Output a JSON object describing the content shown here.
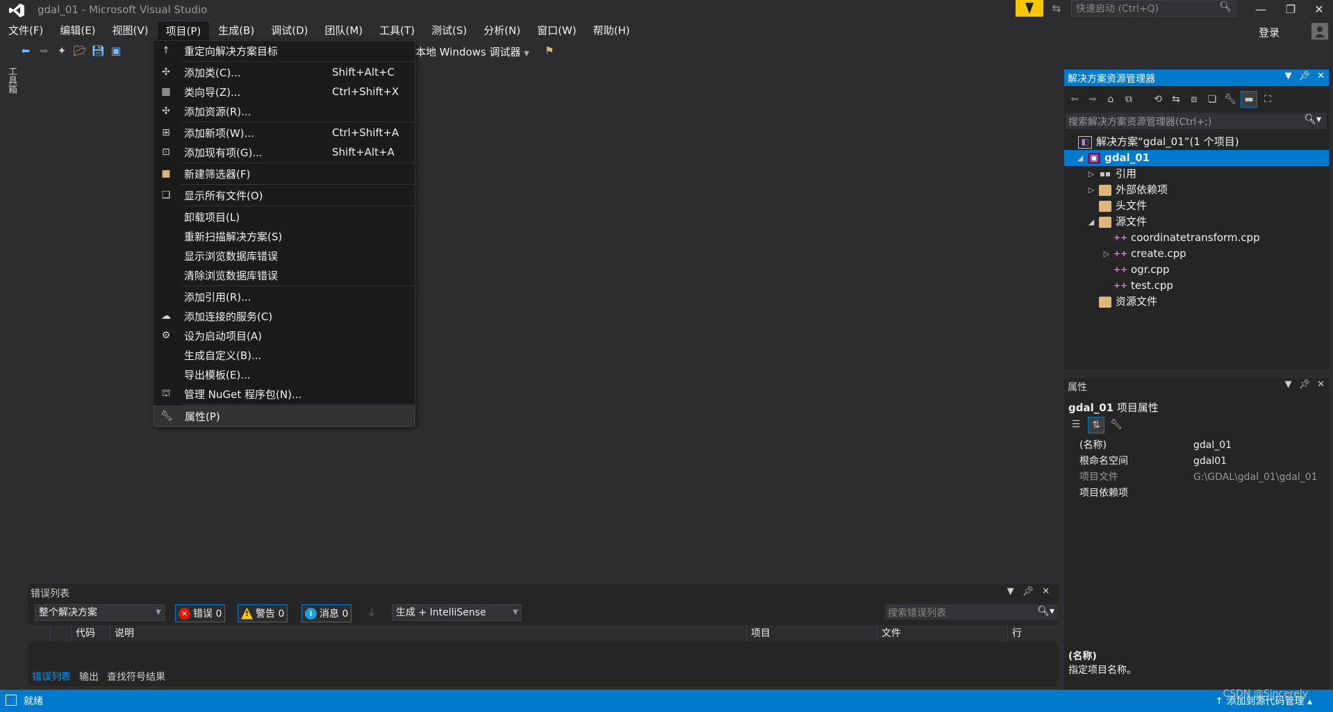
{
  "window": {
    "title": "gdal_01 - Microsoft Visual Studio"
  },
  "quick_launch": {
    "placeholder": "快速启动 (Ctrl+Q)"
  },
  "menubar": [
    {
      "label": "文件(F)"
    },
    {
      "label": "编辑(E)"
    },
    {
      "label": "视图(V)"
    },
    {
      "label": "项目(P)"
    },
    {
      "label": "生成(B)"
    },
    {
      "label": "调试(D)"
    },
    {
      "label": "团队(M)"
    },
    {
      "label": "工具(T)"
    },
    {
      "label": "测试(S)"
    },
    {
      "label": "分析(N)"
    },
    {
      "label": "窗口(W)"
    },
    {
      "label": "帮助(H)"
    }
  ],
  "account": {
    "login": "登录"
  },
  "toolbar": {
    "debugger": "本地 Windows 调试器"
  },
  "toolbox": {
    "label": "工具箱"
  },
  "project_menu": [
    {
      "label": "重定向解决方案目标",
      "shortcut": ""
    },
    {
      "label": "添加类(C)...",
      "shortcut": "Shift+Alt+C"
    },
    {
      "label": "类向导(Z)...",
      "shortcut": "Ctrl+Shift+X"
    },
    {
      "label": "添加资源(R)...",
      "shortcut": ""
    },
    {
      "label": "添加新项(W)...",
      "shortcut": "Ctrl+Shift+A"
    },
    {
      "label": "添加现有项(G)...",
      "shortcut": "Shift+Alt+A"
    },
    {
      "label": "新建筛选器(F)",
      "shortcut": ""
    },
    {
      "label": "显示所有文件(O)",
      "shortcut": ""
    },
    {
      "label": "卸载项目(L)",
      "shortcut": ""
    },
    {
      "label": "重新扫描解决方案(S)",
      "shortcut": ""
    },
    {
      "label": "显示浏览数据库错误",
      "shortcut": ""
    },
    {
      "label": "清除浏览数据库错误",
      "shortcut": ""
    },
    {
      "label": "添加引用(R)...",
      "shortcut": ""
    },
    {
      "label": "添加连接的服务(C)",
      "shortcut": ""
    },
    {
      "label": "设为启动项目(A)",
      "shortcut": ""
    },
    {
      "label": "生成自定义(B)...",
      "shortcut": ""
    },
    {
      "label": "导出模板(E)...",
      "shortcut": ""
    },
    {
      "label": "管理 NuGet 程序包(N)...",
      "shortcut": ""
    },
    {
      "label": "属性(P)",
      "shortcut": ""
    }
  ],
  "solution_explorer": {
    "title": "解决方案资源管理器",
    "search_placeholder": "搜索解决方案资源管理器(Ctrl+;)",
    "tree": {
      "solution": "解决方案“gdal_01”(1 个项目)",
      "project": "gdal_01",
      "references": "引用",
      "external_deps": "外部依赖项",
      "headers": "头文件",
      "sources": "源文件",
      "files": [
        "coordinatetransform.cpp",
        "create.cpp",
        "ogr.cpp",
        "test.cpp"
      ],
      "resources": "资源文件"
    }
  },
  "properties": {
    "title": "属性",
    "object_name": "gdal_01",
    "object_type": "项目属性",
    "rows": [
      {
        "name": "(名称)",
        "value": "gdal_01"
      },
      {
        "name": "根命名空间",
        "value": "gdal01"
      },
      {
        "name": "项目文件",
        "value": "G:\\GDAL\\gdal_01\\gdal_01"
      },
      {
        "name": "项目依赖项",
        "value": ""
      }
    ],
    "desc_title": "(名称)",
    "desc_text": "指定项目名称。"
  },
  "error_list": {
    "title": "错误列表",
    "scope": "整个解决方案",
    "errors": "错误 0",
    "warnings": "警告 0",
    "messages": "消息 0",
    "build_filter": "生成 + IntelliSense",
    "search_placeholder": "搜索错误列表",
    "columns": {
      "code": "代码",
      "desc": "说明",
      "project": "项目",
      "file": "文件",
      "line": "行"
    }
  },
  "bottom_tabs": [
    "错误列表",
    "输出",
    "查找符号结果"
  ],
  "statusbar": {
    "text": "就绪",
    "right": "添加到源代码管理",
    "watermark": "CSDN @Sincerely"
  },
  "colors": {
    "accent": "#007acc",
    "background": "#2d2d30",
    "panel": "#252526",
    "notification": "#f7c600"
  }
}
